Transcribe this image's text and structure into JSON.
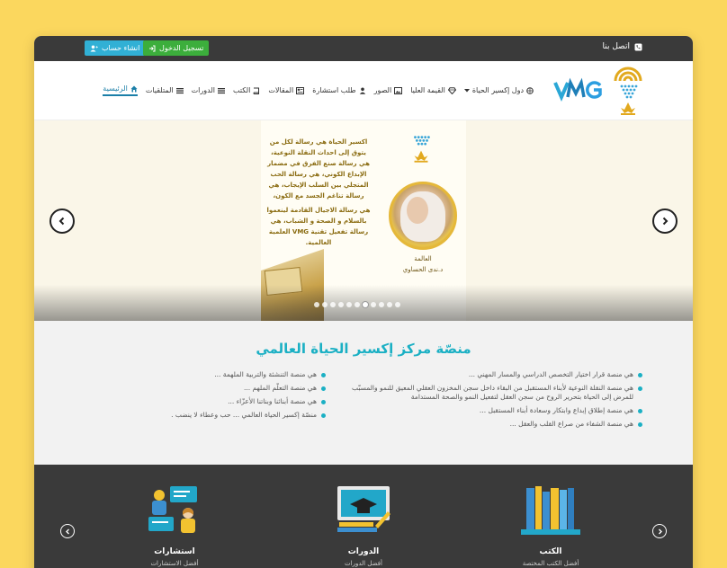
{
  "topbar": {
    "signup_label": "انشاء حساب",
    "login_label": "تسجيل الدخول",
    "contact_label": "اتصل بنا"
  },
  "brand": {
    "logo_text": "VMG"
  },
  "nav": {
    "items": [
      {
        "label": "الرئيسية",
        "icon": "home-icon",
        "active": true
      },
      {
        "label": "المتلقيات",
        "icon": "list-icon"
      },
      {
        "label": "الدورات",
        "icon": "list-icon"
      },
      {
        "label": "الكتب",
        "icon": "book-icon"
      },
      {
        "label": "المقالات",
        "icon": "newspaper-icon"
      },
      {
        "label": "طلب استشارة",
        "icon": "user-icon"
      },
      {
        "label": "الصور",
        "icon": "image-icon"
      },
      {
        "label": "القيمة العليا",
        "icon": "diamond-icon"
      },
      {
        "label": "دول إكسير الحياة",
        "icon": "dropdown-icon"
      }
    ]
  },
  "hero": {
    "poster_text_1": "اكسير الحياة هي رسالة لكل من يتوق إلى احداث النقلة النوعية، هي رسالة صنع الفرق في مضمار الإبداع الكوني، هي رسالة الحب المتجلي بين السلب الإيجاب، هي رسالة تناغم الجسد مع الكون،",
    "poster_text_2": "هي رسالة الاجيال القادمة لينعموا بالسلام و الصحة و الشباب، هي رسالة تفعيل تقنية VMG العلمية العالمية.",
    "caption_title": "العالمة",
    "caption_name": "د.ندى الحساوي",
    "slides_total": 11,
    "active_slide": 7
  },
  "about": {
    "title": "منصّة مركز إكسير الحياة العالمي",
    "right_points": [
      "هي منصة قرار اختيار التخصص الدراسي والمسار المهني ...",
      "هي منصة النقلة النوعية لأبناء المستقبل من البقاء داخل سجن المخزون العقلي المعيق للنمو والمسبّب للمرض إلى الحياة بتحرير الروح من سجن العقل لتفعيل النمو والصحة المستدامة",
      "هي منصة إطلاق إبداع وابتكار وسعادة أبناء المستقبل ...",
      "هي منصة الشفاء من صراع القلب والعقل ..."
    ],
    "left_points": [
      "هي منصة التنشئة والتربية الملهمة ...",
      "هي منصة التعلّم الملهم ...",
      "هي منصة أبنائنا وبناتنا الأعزّاء ...",
      "منصّة إكسير الحياة العالمي ... حب وعطاء لا ينضب ."
    ]
  },
  "services": {
    "items": [
      {
        "title": "الكتب",
        "subtitle": "أفضل الكتب المختصة"
      },
      {
        "title": "الدورات",
        "subtitle": "أفضل الدورات"
      },
      {
        "title": "استشارات",
        "subtitle": "أفضل الاستشارات"
      }
    ]
  },
  "colors": {
    "accent": "#1bb0c4",
    "topbar": "#3a3a3a",
    "background": "#fbd75e"
  }
}
